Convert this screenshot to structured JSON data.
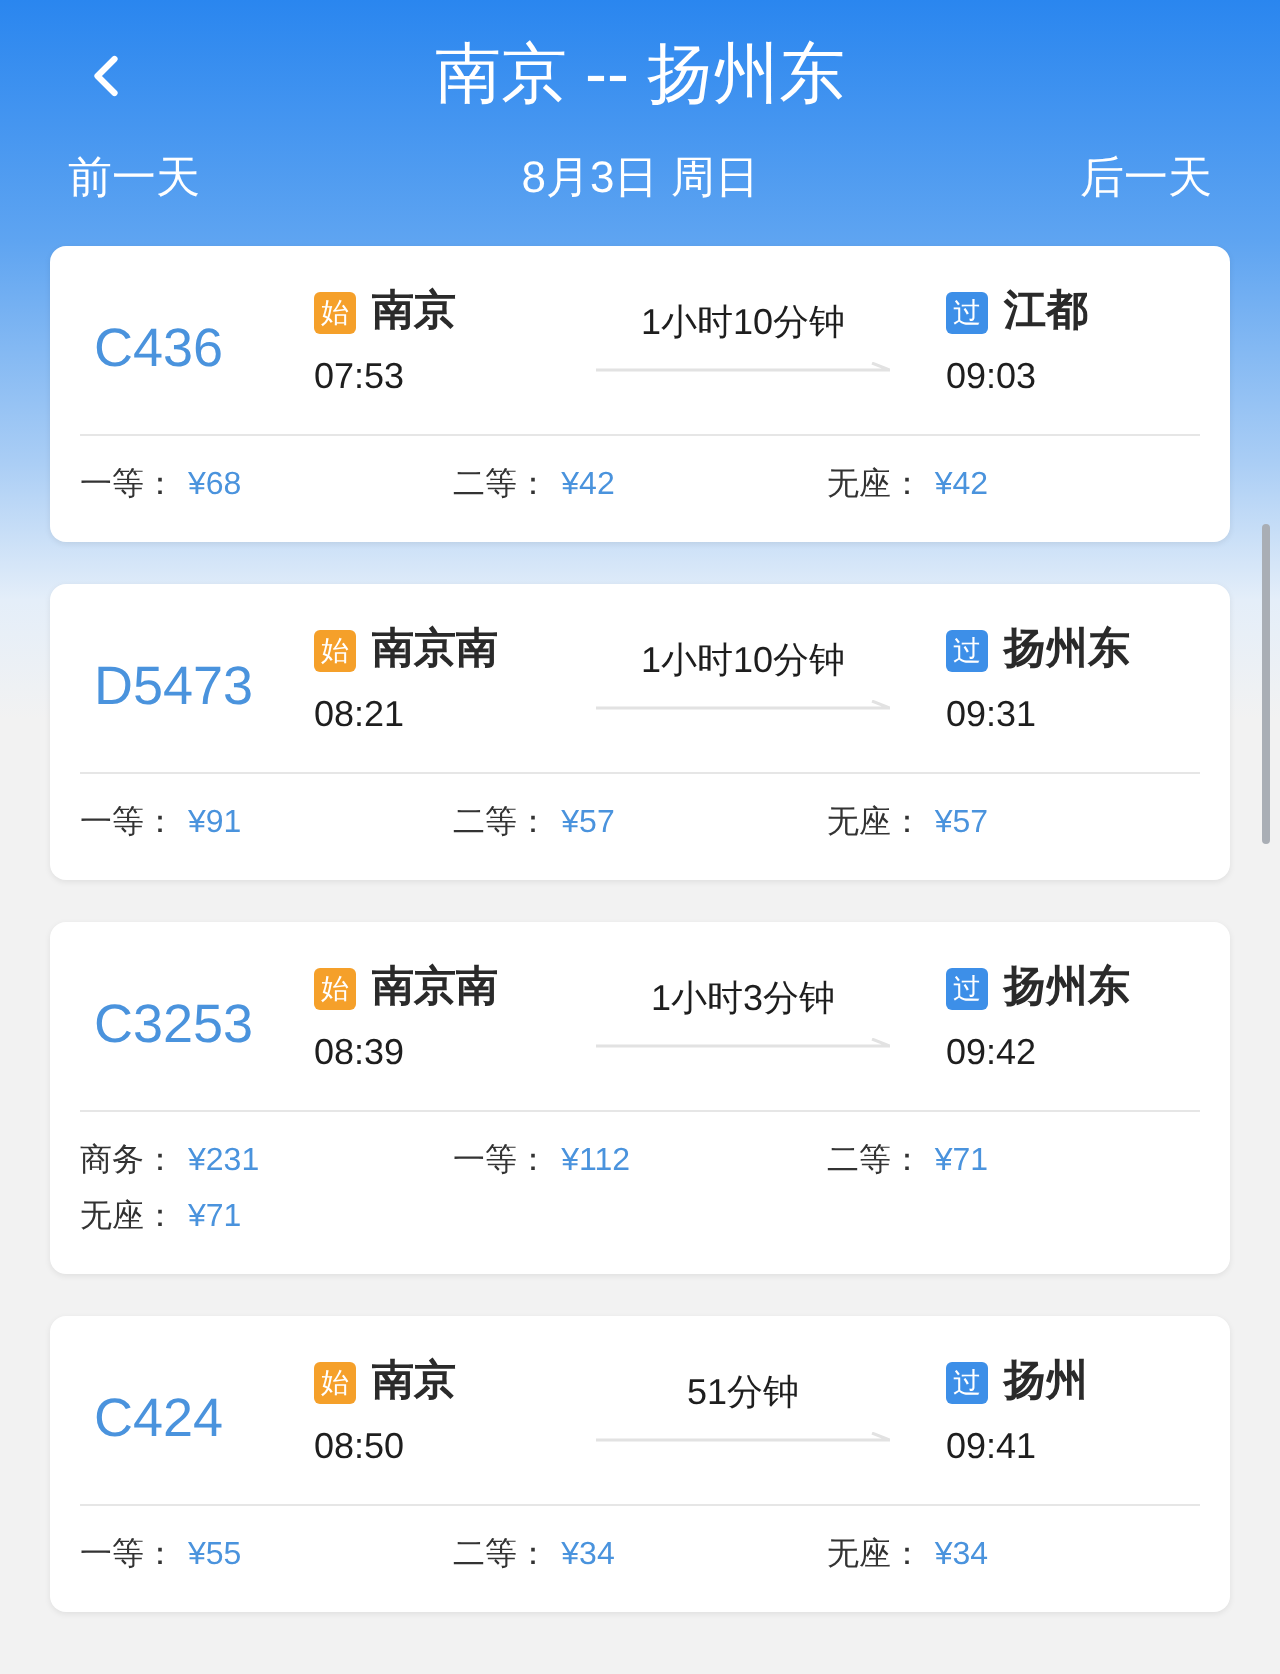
{
  "header": {
    "title": "南京 -- 扬州东",
    "prev_day": "前一天",
    "date": "8月3日 周日",
    "next_day": "后一天"
  },
  "trains": [
    {
      "number": "C436",
      "from": {
        "kind": "origin",
        "tag": "始",
        "station": "南京",
        "time": "07:53"
      },
      "duration": "1小时10分钟",
      "to": {
        "kind": "pass",
        "tag": "过",
        "station": "江都",
        "time": "09:03"
      },
      "prices": [
        {
          "seat": "一等：",
          "price": "¥68"
        },
        {
          "seat": "二等：",
          "price": "¥42"
        },
        {
          "seat": "无座：",
          "price": "¥42"
        }
      ]
    },
    {
      "number": "D5473",
      "from": {
        "kind": "origin",
        "tag": "始",
        "station": "南京南",
        "time": "08:21"
      },
      "duration": "1小时10分钟",
      "to": {
        "kind": "pass",
        "tag": "过",
        "station": "扬州东",
        "time": "09:31"
      },
      "prices": [
        {
          "seat": "一等：",
          "price": "¥91"
        },
        {
          "seat": "二等：",
          "price": "¥57"
        },
        {
          "seat": "无座：",
          "price": "¥57"
        }
      ]
    },
    {
      "number": "C3253",
      "from": {
        "kind": "origin",
        "tag": "始",
        "station": "南京南",
        "time": "08:39"
      },
      "duration": "1小时3分钟",
      "to": {
        "kind": "pass",
        "tag": "过",
        "station": "扬州东",
        "time": "09:42"
      },
      "prices": [
        {
          "seat": "商务：",
          "price": "¥231"
        },
        {
          "seat": "一等：",
          "price": "¥112"
        },
        {
          "seat": "二等：",
          "price": "¥71"
        },
        {
          "seat": "无座：",
          "price": "¥71"
        }
      ]
    },
    {
      "number": "C424",
      "from": {
        "kind": "origin",
        "tag": "始",
        "station": "南京",
        "time": "08:50"
      },
      "duration": "51分钟",
      "to": {
        "kind": "pass",
        "tag": "过",
        "station": "扬州",
        "time": "09:41"
      },
      "prices": [
        {
          "seat": "一等：",
          "price": "¥55"
        },
        {
          "seat": "二等：",
          "price": "¥34"
        },
        {
          "seat": "无座：",
          "price": "¥34"
        }
      ]
    }
  ]
}
